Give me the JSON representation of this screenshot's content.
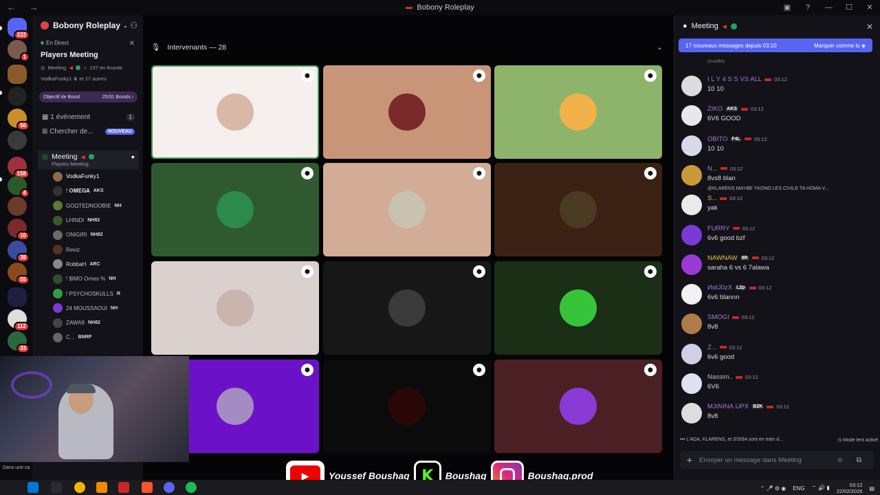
{
  "window": {
    "title": "Bobony Roleplay",
    "nav": "← →"
  },
  "server_rail": {
    "badges": [
      "222",
      "1",
      "56",
      "158",
      "4",
      "10",
      "38",
      "55",
      "112",
      "33"
    ]
  },
  "sidebar": {
    "server_name": "Bobony Roleplay",
    "live_label": "En Direct",
    "live_title": "Players Meeting",
    "live_meta": "Meeting",
    "listeners": "157 en écoute",
    "live_users": "VodkaFunky1",
    "others": "et 27 autres",
    "boost_label": "Objectif de Boost",
    "boost_progress": "25/31 Boosts",
    "event_label": "1 événement",
    "event_count": "1",
    "search_label": "Chercher de...",
    "new_badge": "NOUVEAU",
    "voice_channel": "Meeting",
    "voice_sub": "Players Meeting",
    "members": [
      {
        "name": "VodkaFunky1",
        "tag": "",
        "color": "#ffffff",
        "av": "#8c6b4a"
      },
      {
        "name": "! 𝐎𝐌𝐄𝐆𝐀",
        "tag": "AKS",
        "color": "#dbdee1",
        "av": "#333"
      },
      {
        "name": "GOΩTEDNOOBIE",
        "tag": "NH",
        "color": "#b5bac1",
        "av": "#5b7a3a"
      },
      {
        "name": "LHINDI",
        "tag": "NH82",
        "color": "#b5bac1",
        "av": "#3a5a2a"
      },
      {
        "name": "ONIGIRI",
        "tag": "NH82",
        "color": "#b5bac1",
        "av": "#6a6a6a"
      },
      {
        "name": "Reviz",
        "tag": "",
        "color": "#b5bac1",
        "av": "#553322"
      },
      {
        "name": "RobbaH",
        "tag": "ARC",
        "color": "#dbdee1",
        "av": "#888"
      },
      {
        "name": "! $IMO Ornes %",
        "tag": "NH",
        "color": "#b5bac1",
        "av": "#2e4d2e"
      },
      {
        "name": "! PSYCHOSKULLS",
        "tag": "R",
        "color": "#b5bac1",
        "av": "#2ea043"
      },
      {
        "name": "24 MOUSSAOUI",
        "tag": "NH",
        "color": "#b5bac1",
        "av": "#7a3ad4"
      },
      {
        "name": "ZAWA9",
        "tag": "NH82",
        "color": "#b5bac1",
        "av": "#444"
      },
      {
        "name": "C...",
        "tag": "BNRP",
        "color": "#b5bac1",
        "av": "#666"
      }
    ]
  },
  "stage": {
    "header": "Intervenants — 28",
    "tiles": [
      {
        "bg": "#f5efee",
        "av": "#d9b8a8",
        "selected": true
      },
      {
        "bg": "#c99578",
        "av": "#7a2a2a"
      },
      {
        "bg": "#8eb36a",
        "av": "#f2b14a"
      },
      {
        "bg": "#2f5a30",
        "av": "#2c8a4a"
      },
      {
        "bg": "#d2ac95",
        "av": "#c9c2b0"
      },
      {
        "bg": "#3b2114",
        "av": "#4b3a22"
      },
      {
        "bg": "#dad1ce",
        "av": "#c9b5ae"
      },
      {
        "bg": "#171717",
        "av": "#3a3a3a"
      },
      {
        "bg": "#1b2e16",
        "av": "#38c43a"
      },
      {
        "bg": "#6b12c9",
        "av": "#a48cc2"
      },
      {
        "bg": "#0b0b0b",
        "av": "#2a0707"
      },
      {
        "bg": "#4b2025",
        "av": "#8a3ad4"
      }
    ]
  },
  "chat": {
    "title": "Meeting",
    "banner_text": "17 nouveaux messages depuis 03:10",
    "banner_action": "Marquer comme lu",
    "edited": "(modifié)",
    "messages": [
      {
        "name": "I L Y 4 S S  VS ALL",
        "color": "#a27be0",
        "time": "03:12",
        "text": "10 10",
        "av": "#dcdcdc",
        "badge": ""
      },
      {
        "name": "ZIKO",
        "color": "#a27be0",
        "time": "03:12",
        "text": "6V6 GOOD",
        "av": "#e8e8e8",
        "badge": "AKS"
      },
      {
        "name": "OBITO",
        "color": "#a27be0",
        "time": "03:12",
        "text": "10 10",
        "av": "#d8d8e8",
        "badge": "F4L"
      },
      {
        "name": "N...",
        "color": "#a27be0",
        "time": "03:12",
        "text": "8vs8 blan",
        "av": "#c99a3a",
        "badge": ""
      },
      {
        "name": "S...",
        "color": "#f0c040",
        "time": "03:12",
        "text": "yak",
        "av": "#eaeaea",
        "badge": "",
        "reply": "@KLARENS  MAYBE YKONO LES CIVILE TA HOMA V..."
      },
      {
        "name": "FURRY",
        "color": "#a27be0",
        "time": "03:12",
        "text": "6v6 good bzf",
        "av": "#7a3ad4",
        "badge": ""
      },
      {
        "name": "NAWNAW",
        "color": "#f0c040",
        "time": "03:12",
        "text": "saraha 6 vs 6 7alawa",
        "av": "#9a3ad4",
        "badge": "8R"
      },
      {
        "name": "ИαIJ0zX",
        "color": "#a27be0",
        "time": "03:12",
        "text": "6v6 blannn",
        "av": "#f2f2f2",
        "badge": "L2p"
      },
      {
        "name": "SMOGI",
        "color": "#a27be0",
        "time": "03:12",
        "text": "8v8",
        "av": "#b07a4a",
        "badge": ""
      },
      {
        "name": "Z...",
        "color": "#a27be0",
        "time": "03:12",
        "text": "6v6 good",
        "av": "#cfcfe6",
        "badge": ""
      },
      {
        "name": "Nassim..",
        "color": "#b5bac1",
        "time": "03:12",
        "text": "6V6",
        "av": "#e0e0f0",
        "badge": ""
      },
      {
        "name": "MJININA.UPX",
        "color": "#a27be0",
        "time": "03:12",
        "text": "8v8",
        "av": "#dddddd",
        "badge": "B2K"
      }
    ],
    "typing": "L'ADA, KLARENS, et 3!SI9A sont en train d...",
    "slow_mode": "Mode lent activé.",
    "composer_placeholder": "Envoyer un message dans Meeting"
  },
  "overlay": {
    "cam_label": "Dans une ca",
    "youtube_name": "Youssef Boushaq",
    "kick_name": "Boushaq",
    "instagram_name": "Boushaq.prod"
  },
  "taskbar": {
    "lang": "ENG",
    "time": "03:12",
    "date": "22/02/2026"
  }
}
